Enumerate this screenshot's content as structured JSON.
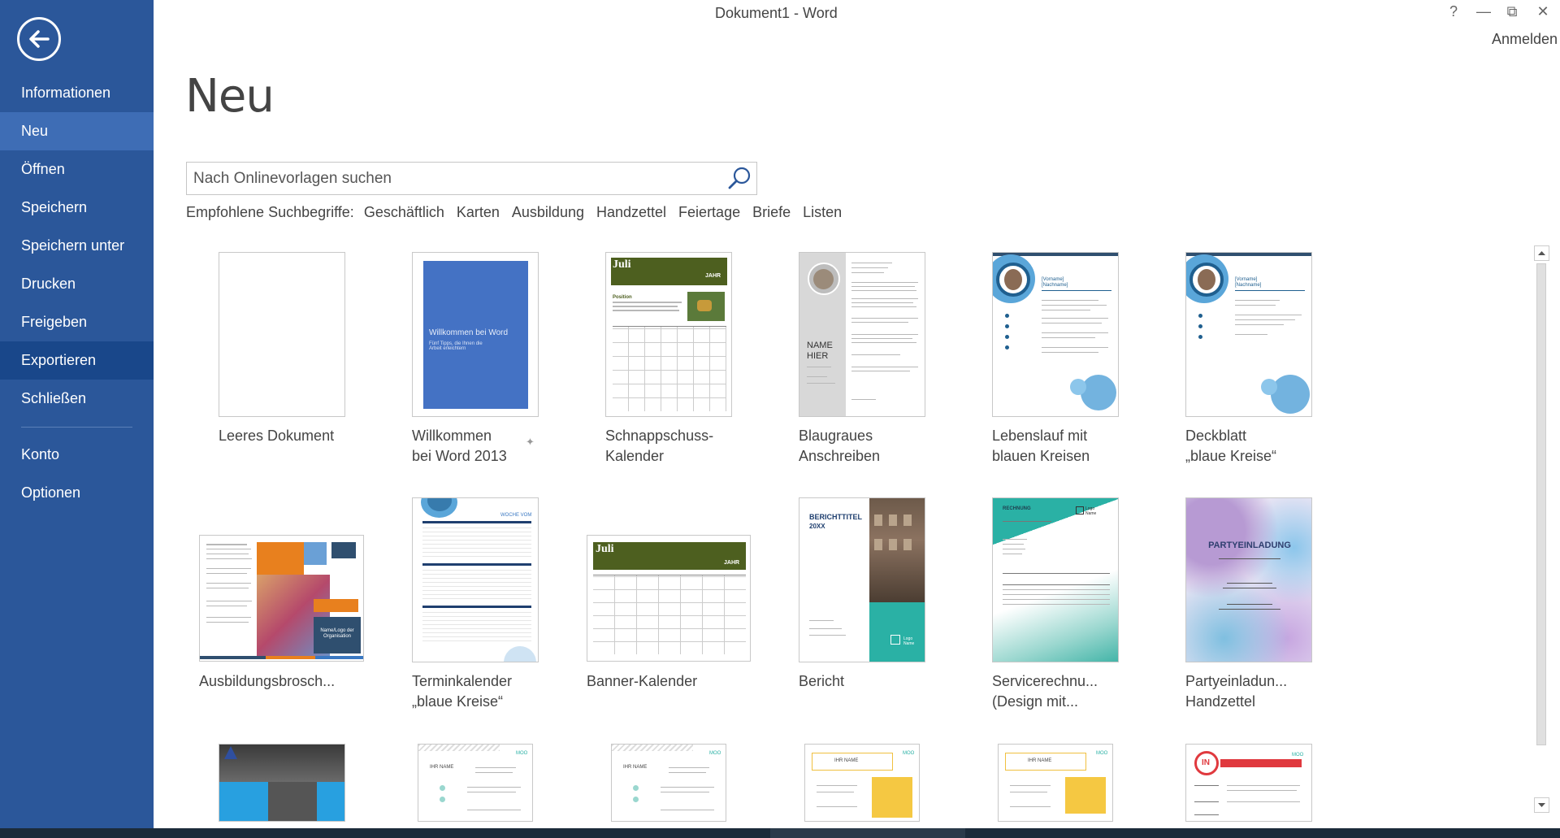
{
  "window": {
    "title": "Dokument1 - Word",
    "signin": "Anmelden",
    "help": "?",
    "minimize": "—",
    "restore": "⧉",
    "close": "✕"
  },
  "sidebar": {
    "items": [
      {
        "label": "Informationen"
      },
      {
        "label": "Neu"
      },
      {
        "label": "Öffnen"
      },
      {
        "label": "Speichern"
      },
      {
        "label": "Speichern unter"
      },
      {
        "label": "Drucken"
      },
      {
        "label": "Freigeben"
      },
      {
        "label": "Exportieren"
      },
      {
        "label": "Schließen"
      },
      {
        "label": "Konto"
      },
      {
        "label": "Optionen"
      }
    ],
    "selected": "Neu"
  },
  "main": {
    "heading": "Neu",
    "search_placeholder": "Nach Onlinevorlagen suchen",
    "suggested_label": "Empfohlene Suchbegriffe:",
    "suggested_terms": [
      "Geschäftlich",
      "Karten",
      "Ausbildung",
      "Handzettel",
      "Feiertage",
      "Briefe",
      "Listen"
    ]
  },
  "templates": [
    {
      "name_line1": "Leeres Dokument",
      "name_line2": ""
    },
    {
      "name_line1": "Willkommen",
      "name_line2": "bei Word 2013"
    },
    {
      "name_line1": "Schnappschuss-",
      "name_line2": "Kalender"
    },
    {
      "name_line1": "Blaugraues",
      "name_line2": "Anschreiben"
    },
    {
      "name_line1": "Lebenslauf mit",
      "name_line2": "blauen Kreisen"
    },
    {
      "name_line1": "Deckblatt",
      "name_line2": "„blaue Kreise“"
    },
    {
      "name_line1": "Ausbildungsbrosch...",
      "name_line2": ""
    },
    {
      "name_line1": "Terminkalender",
      "name_line2": "„blaue Kreise“"
    },
    {
      "name_line1": "Banner-Kalender",
      "name_line2": ""
    },
    {
      "name_line1": "Bericht",
      "name_line2": ""
    },
    {
      "name_line1": "Servicerechnu...",
      "name_line2": "(Design mit..."
    },
    {
      "name_line1": "Partyeinladun...",
      "name_line2": "Handzettel"
    }
  ],
  "thumb_text": {
    "welcome_title": "Willkommen bei Word",
    "welcome_sub": "Fünf Tipps, die Ihnen die Arbeit erleichtern",
    "cal_month": "Juli",
    "cal_year": "JAHR",
    "cal_position": "Position",
    "name_hier": "NAME HIER",
    "vorname": "[Vorname]",
    "nachname": "[Nachname]",
    "woche": "WOCHE VOM",
    "bericht_title": "BERICHTTITEL",
    "bericht_year": "20XX",
    "rechnung": "RECHNUNG",
    "party": "PARTYEINLADUNG",
    "logo": "Logo Name",
    "ihr_name": "IHR NAME",
    "moo": "MOO",
    "in_badge": "IN",
    "org": "Name/Logo der Organisation"
  },
  "colors": {
    "sidebar": "#2b579a",
    "sidebar_selected": "#3e6db5",
    "accent_green": "#4d5f1f",
    "accent_teal": "#2ab1a5",
    "accent_blue": "#4472c4"
  }
}
